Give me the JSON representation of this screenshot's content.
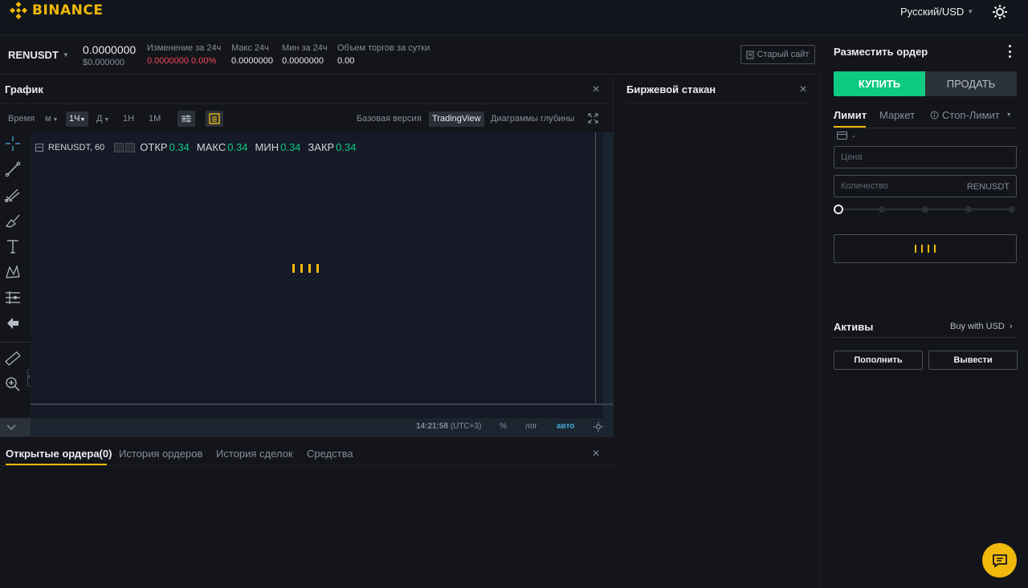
{
  "header": {
    "logo_text": "BINANCE",
    "language": "Русский/USD"
  },
  "ticker": {
    "symbol": "RENUSDT",
    "last_price": "0.0000000",
    "last_price_usd": "$0.000000",
    "change_label": "Изменение за 24ч",
    "change_value": "0.0000000 0.00%",
    "high_label": "Макс 24ч",
    "high_value": "0.0000000",
    "low_label": "Мин за 24ч",
    "low_value": "0.0000000",
    "volume_label": "Объем торгов за сутки",
    "volume_value": "0.00",
    "old_site": "Старый сайт"
  },
  "chart_panel": {
    "title": "График",
    "toolbar": {
      "time": "Время",
      "minute": "м",
      "hour": "1Ч",
      "day": "Д",
      "week": "1Н",
      "month": "1М",
      "basic": "Базовая версия",
      "tradingview": "TradingView",
      "depth": "Диаграммы глубины"
    },
    "legend": {
      "symbol": "RENUSDT, 60",
      "open_label": "ОТКР",
      "open_value": "0.34",
      "high_label": "МАКС",
      "high_value": "0.34",
      "low_label": "МИН",
      "low_value": "0.34",
      "close_label": "ЗАКР",
      "close_value": "0.34"
    },
    "status": {
      "time": "14:21:58",
      "tz": "(UTC+3)",
      "percent": "%",
      "log": "лог",
      "auto": "авто"
    }
  },
  "order_book": {
    "title": "Биржевой стакан"
  },
  "orders": {
    "tabs": [
      "Открытые ордера(0)",
      "История ордеров",
      "История сделок",
      "Средства"
    ]
  },
  "order_form": {
    "title": "Разместить ордер",
    "buy": "КУПИТЬ",
    "sell": "ПРОДАТЬ",
    "types": [
      "Лимит",
      "Маркет",
      "Стоп-Лимит"
    ],
    "wallet_value": "-",
    "price_placeholder": "Цена",
    "amount_placeholder": "Количество",
    "amount_unit": "RENUSDT",
    "slider_percent": 0
  },
  "assets": {
    "title": "Активы",
    "buy_with": "Buy with USD",
    "deposit": "Пополнить",
    "withdraw": "Вывести"
  },
  "colors": {
    "accent": "#f0b90b",
    "buy": "#0ecb81",
    "sell": "#f6465d"
  }
}
